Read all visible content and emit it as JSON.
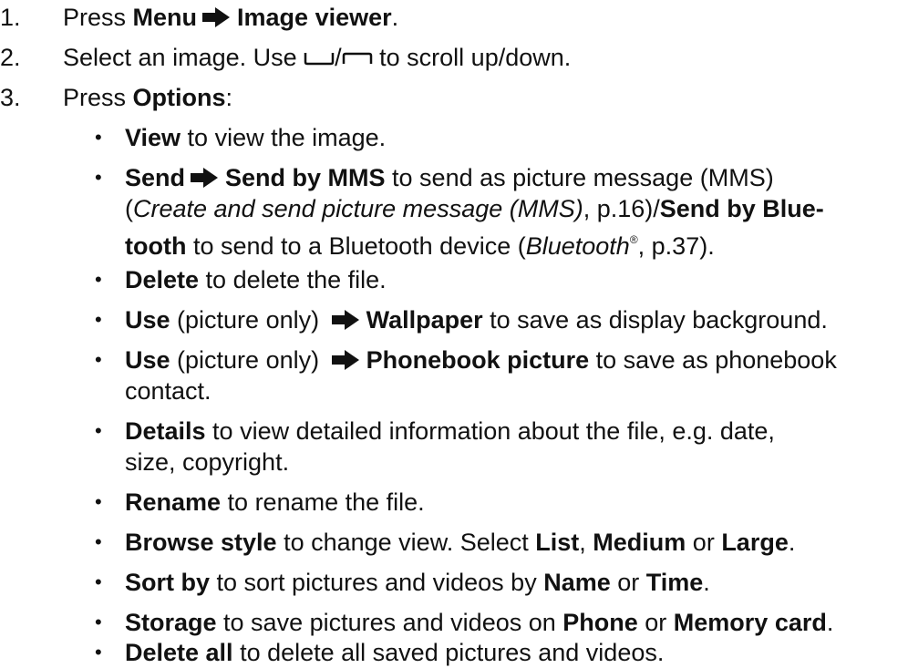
{
  "steps": [
    {
      "num": "1.",
      "t1": "Press ",
      "b1": "Menu",
      "b2": "Image viewer",
      "t2": "."
    },
    {
      "num": "2.",
      "t1": "Select an image. Use ",
      "sep": "/",
      "t2": " to scroll up/down."
    },
    {
      "num": "3.",
      "t1": "Press ",
      "b1": "Options",
      "t2": ":"
    }
  ],
  "bullet_char": "•",
  "items": {
    "view": {
      "b": "View",
      "t": " to view the image."
    },
    "send": {
      "b1": "Send",
      "b2": "Send by MMS",
      "t1": " to send as picture message (MMS)",
      "t2a": "(",
      "i1": "Create and send picture message (MMS)",
      "t2b": ", p.16)/",
      "b3": "Send by Blue-",
      "b4": "tooth",
      "t3a": " to send to a Bluetooth device (",
      "i2": "Bluetooth",
      "sup": "®",
      "t3b": ", p.37)."
    },
    "delete": {
      "b": "Delete",
      "t": " to delete the file."
    },
    "use_wallpaper": {
      "b1": "Use",
      "t1": " (picture only) ",
      "b2": "Wallpaper",
      "t2": " to save as display background."
    },
    "use_phonebook": {
      "b1": "Use",
      "t1": " (picture only) ",
      "b2": "Phonebook picture",
      "t2": " to save as phonebook",
      "t3": "contact."
    },
    "details": {
      "b": "Details",
      "t1": " to view detailed information about the file, e.g. date,",
      "t2": "size, copyright."
    },
    "rename": {
      "b": "Rename",
      "t": " to rename the file."
    },
    "browse": {
      "b1": "Browse style",
      "t1": " to change view. Select ",
      "b2": "List",
      "t2": ", ",
      "b3": "Medium",
      "t3": " or ",
      "b4": "Large",
      "t4": "."
    },
    "sort": {
      "b1": "Sort by",
      "t1": " to sort pictures and videos by ",
      "b2": "Name",
      "t2": " or ",
      "b3": "Time",
      "t3": "."
    },
    "storage": {
      "b1": "Storage",
      "t1": " to save pictures and videos on ",
      "b2": "Phone",
      "t2": " or ",
      "b3": "Memory card",
      "t3": "."
    },
    "delete_all": {
      "b": "Delete all",
      "t": " to delete all saved pictures and videos."
    }
  }
}
